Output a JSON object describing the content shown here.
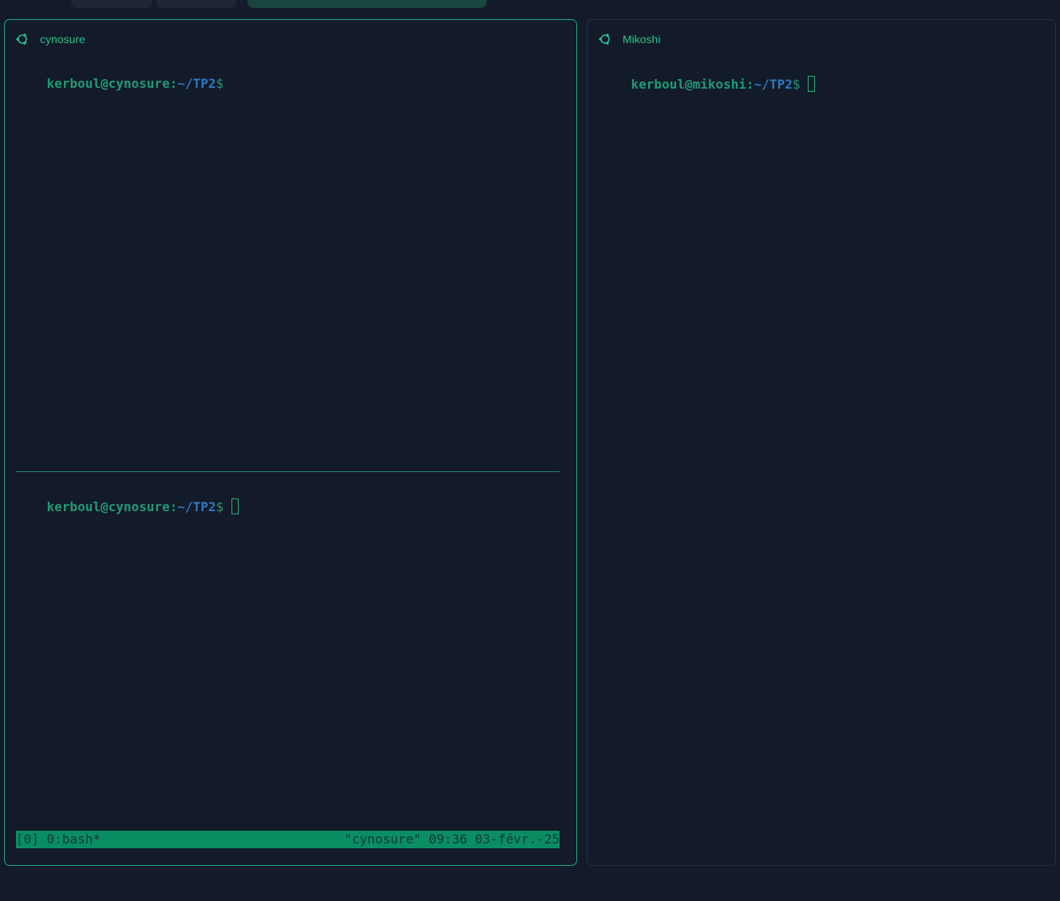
{
  "colors": {
    "background": "#131a29",
    "accent_green": "#1fa97a",
    "status_bar_bg": "#0b8d64",
    "path_blue": "#2d7ac1"
  },
  "panes": {
    "left": {
      "icon": "ubuntu-icon",
      "title": "cynosure",
      "top_prompt": {
        "user_host": "kerboul@cynosure",
        "colon": ":",
        "path": "~/TP2",
        "dollar": "$"
      },
      "bottom_prompt": {
        "user_host": "kerboul@cynosure",
        "colon": ":",
        "path": "~/TP2",
        "dollar": "$"
      },
      "status_bar": {
        "left": "[0] 0:bash*",
        "right": "\"cynosure\" 09:36 03-févr.-25"
      }
    },
    "right": {
      "icon": "ubuntu-icon",
      "title": "Mikoshi",
      "prompt": {
        "user_host": "kerboul@mikoshi",
        "colon": ":",
        "path": "~/TP2",
        "dollar": "$"
      }
    }
  }
}
